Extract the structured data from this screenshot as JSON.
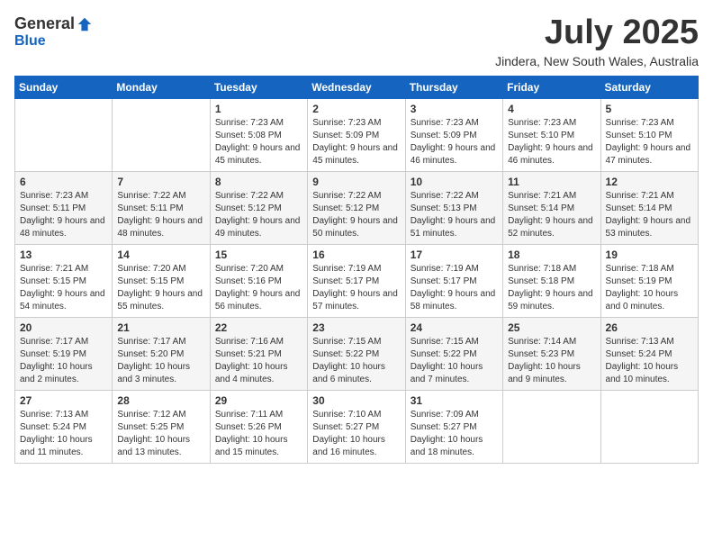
{
  "logo": {
    "general": "General",
    "blue": "Blue"
  },
  "header": {
    "month": "July 2025",
    "location": "Jindera, New South Wales, Australia"
  },
  "weekdays": [
    "Sunday",
    "Monday",
    "Tuesday",
    "Wednesday",
    "Thursday",
    "Friday",
    "Saturday"
  ],
  "weeks": [
    [
      {
        "day": "",
        "info": ""
      },
      {
        "day": "",
        "info": ""
      },
      {
        "day": "1",
        "info": "Sunrise: 7:23 AM\nSunset: 5:08 PM\nDaylight: 9 hours\nand 45 minutes."
      },
      {
        "day": "2",
        "info": "Sunrise: 7:23 AM\nSunset: 5:09 PM\nDaylight: 9 hours\nand 45 minutes."
      },
      {
        "day": "3",
        "info": "Sunrise: 7:23 AM\nSunset: 5:09 PM\nDaylight: 9 hours\nand 46 minutes."
      },
      {
        "day": "4",
        "info": "Sunrise: 7:23 AM\nSunset: 5:10 PM\nDaylight: 9 hours\nand 46 minutes."
      },
      {
        "day": "5",
        "info": "Sunrise: 7:23 AM\nSunset: 5:10 PM\nDaylight: 9 hours\nand 47 minutes."
      }
    ],
    [
      {
        "day": "6",
        "info": "Sunrise: 7:23 AM\nSunset: 5:11 PM\nDaylight: 9 hours\nand 48 minutes."
      },
      {
        "day": "7",
        "info": "Sunrise: 7:22 AM\nSunset: 5:11 PM\nDaylight: 9 hours\nand 48 minutes."
      },
      {
        "day": "8",
        "info": "Sunrise: 7:22 AM\nSunset: 5:12 PM\nDaylight: 9 hours\nand 49 minutes."
      },
      {
        "day": "9",
        "info": "Sunrise: 7:22 AM\nSunset: 5:12 PM\nDaylight: 9 hours\nand 50 minutes."
      },
      {
        "day": "10",
        "info": "Sunrise: 7:22 AM\nSunset: 5:13 PM\nDaylight: 9 hours\nand 51 minutes."
      },
      {
        "day": "11",
        "info": "Sunrise: 7:21 AM\nSunset: 5:14 PM\nDaylight: 9 hours\nand 52 minutes."
      },
      {
        "day": "12",
        "info": "Sunrise: 7:21 AM\nSunset: 5:14 PM\nDaylight: 9 hours\nand 53 minutes."
      }
    ],
    [
      {
        "day": "13",
        "info": "Sunrise: 7:21 AM\nSunset: 5:15 PM\nDaylight: 9 hours\nand 54 minutes."
      },
      {
        "day": "14",
        "info": "Sunrise: 7:20 AM\nSunset: 5:15 PM\nDaylight: 9 hours\nand 55 minutes."
      },
      {
        "day": "15",
        "info": "Sunrise: 7:20 AM\nSunset: 5:16 PM\nDaylight: 9 hours\nand 56 minutes."
      },
      {
        "day": "16",
        "info": "Sunrise: 7:19 AM\nSunset: 5:17 PM\nDaylight: 9 hours\nand 57 minutes."
      },
      {
        "day": "17",
        "info": "Sunrise: 7:19 AM\nSunset: 5:17 PM\nDaylight: 9 hours\nand 58 minutes."
      },
      {
        "day": "18",
        "info": "Sunrise: 7:18 AM\nSunset: 5:18 PM\nDaylight: 9 hours\nand 59 minutes."
      },
      {
        "day": "19",
        "info": "Sunrise: 7:18 AM\nSunset: 5:19 PM\nDaylight: 10 hours\nand 0 minutes."
      }
    ],
    [
      {
        "day": "20",
        "info": "Sunrise: 7:17 AM\nSunset: 5:19 PM\nDaylight: 10 hours\nand 2 minutes."
      },
      {
        "day": "21",
        "info": "Sunrise: 7:17 AM\nSunset: 5:20 PM\nDaylight: 10 hours\nand 3 minutes."
      },
      {
        "day": "22",
        "info": "Sunrise: 7:16 AM\nSunset: 5:21 PM\nDaylight: 10 hours\nand 4 minutes."
      },
      {
        "day": "23",
        "info": "Sunrise: 7:15 AM\nSunset: 5:22 PM\nDaylight: 10 hours\nand 6 minutes."
      },
      {
        "day": "24",
        "info": "Sunrise: 7:15 AM\nSunset: 5:22 PM\nDaylight: 10 hours\nand 7 minutes."
      },
      {
        "day": "25",
        "info": "Sunrise: 7:14 AM\nSunset: 5:23 PM\nDaylight: 10 hours\nand 9 minutes."
      },
      {
        "day": "26",
        "info": "Sunrise: 7:13 AM\nSunset: 5:24 PM\nDaylight: 10 hours\nand 10 minutes."
      }
    ],
    [
      {
        "day": "27",
        "info": "Sunrise: 7:13 AM\nSunset: 5:24 PM\nDaylight: 10 hours\nand 11 minutes."
      },
      {
        "day": "28",
        "info": "Sunrise: 7:12 AM\nSunset: 5:25 PM\nDaylight: 10 hours\nand 13 minutes."
      },
      {
        "day": "29",
        "info": "Sunrise: 7:11 AM\nSunset: 5:26 PM\nDaylight: 10 hours\nand 15 minutes."
      },
      {
        "day": "30",
        "info": "Sunrise: 7:10 AM\nSunset: 5:27 PM\nDaylight: 10 hours\nand 16 minutes."
      },
      {
        "day": "31",
        "info": "Sunrise: 7:09 AM\nSunset: 5:27 PM\nDaylight: 10 hours\nand 18 minutes."
      },
      {
        "day": "",
        "info": ""
      },
      {
        "day": "",
        "info": ""
      }
    ]
  ]
}
